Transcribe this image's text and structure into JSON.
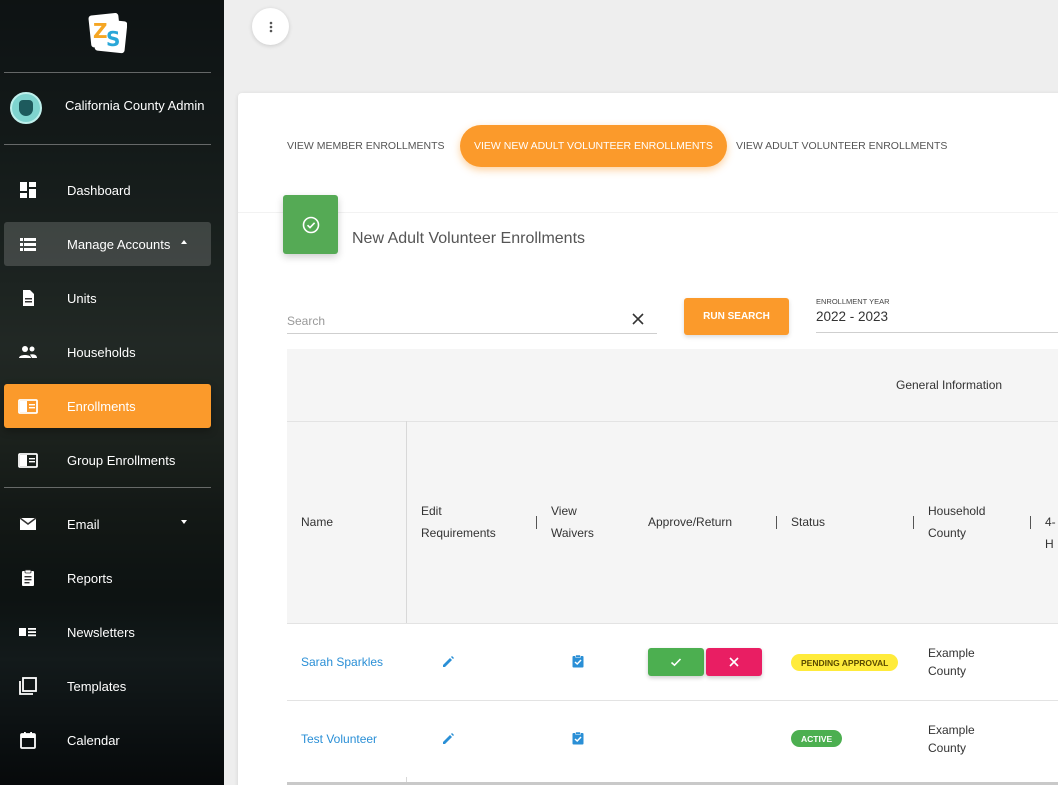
{
  "sidebar": {
    "logo_text": "ZS",
    "user_name": "California County Admin...",
    "items": [
      {
        "label": "Dashboard",
        "icon": "dashboard-icon"
      },
      {
        "label": "Manage Accounts",
        "icon": "list-icon"
      },
      {
        "label": "Units",
        "icon": "document-icon"
      },
      {
        "label": "Households",
        "icon": "people-icon"
      },
      {
        "label": "Enrollments",
        "icon": "enrollment-card-icon"
      },
      {
        "label": "Group Enrollments",
        "icon": "enrollment-card-icon"
      },
      {
        "label": "Email",
        "icon": "mail-icon"
      },
      {
        "label": "Reports",
        "icon": "clipboard-icon"
      },
      {
        "label": "Newsletters",
        "icon": "newsletter-icon"
      },
      {
        "label": "Templates",
        "icon": "copy-icon"
      },
      {
        "label": "Calendar",
        "icon": "calendar-icon"
      }
    ]
  },
  "tabs": [
    {
      "label": "VIEW MEMBER ENROLLMENTS",
      "active": false
    },
    {
      "label": "VIEW NEW ADULT VOLUNTEER ENROLLMENTS",
      "active": true
    },
    {
      "label": "VIEW ADULT VOLUNTEER ENROLLMENTS",
      "active": false
    }
  ],
  "card": {
    "title": "New Adult Volunteer Enrollments",
    "header_icon": "check-circle-icon"
  },
  "search": {
    "placeholder": "Search",
    "value": "",
    "run_label": "RUN SEARCH"
  },
  "enrollment_year": {
    "label": "ENROLLMENT YEAR",
    "value": "2022 - 2023"
  },
  "table": {
    "group_label": "General Information",
    "columns": {
      "name": "Name",
      "edit_1": "Edit",
      "edit_2": "Requirements",
      "waivers_1": "View",
      "waivers_2": "Waivers",
      "approve": "Approve/Return",
      "status": "Status",
      "county_1": "Household",
      "county_2": "County",
      "next": "4-H"
    },
    "rows": [
      {
        "name": "Sarah Sparkles",
        "status": "PENDING APPROVAL",
        "county_1": "Example",
        "county_2": "County"
      },
      {
        "name": "Test Volunteer",
        "status": "ACTIVE",
        "county_1": "Example",
        "county_2": "County"
      }
    ]
  },
  "colors": {
    "accent": "#fb9a2b",
    "success": "#4caf50",
    "danger": "#e91e63",
    "pending": "#ffeb3b",
    "link": "#2a8fd6"
  }
}
